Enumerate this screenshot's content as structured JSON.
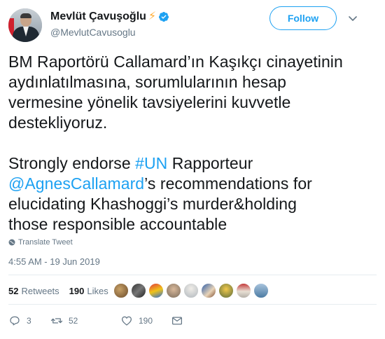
{
  "header": {
    "display_name": "Mevlüt Çavuşoğlu",
    "handle": "@MevlutCavusoglu",
    "follow_label": "Follow"
  },
  "tweet": {
    "lines_tr": [
      "BM Raportörü Callamard’ın Kaşıkçı cinayetinin",
      "aydınlatılmasına, sorumlularının hesap",
      "vermesine yönelik tavsiyelerini kuvvetle",
      "destekliyoruz."
    ],
    "en": {
      "l1_a": "Strongly endorse ",
      "l1_hashtag": "#UN",
      "l1_b": " Rapporteur",
      "l2_mention": "@AgnesCallamard",
      "l2_b": "’s recommendations for",
      "l3": "elucidating Khashoggi’s murder&holding",
      "l4": "those responsible accountable"
    },
    "translate_label": "Translate Tweet",
    "timestamp": "4:55 AM - 19 Jun 2019"
  },
  "stats": {
    "retweets_count": "52",
    "retweets_label": "Retweets",
    "likes_count": "190",
    "likes_label": "Likes"
  },
  "actions": {
    "replies": "3",
    "retweets": "52",
    "likes": "190"
  },
  "colors": {
    "accent": "#1da1f2",
    "muted": "#657786",
    "text": "#14171a",
    "bolt": "#ffac33"
  }
}
